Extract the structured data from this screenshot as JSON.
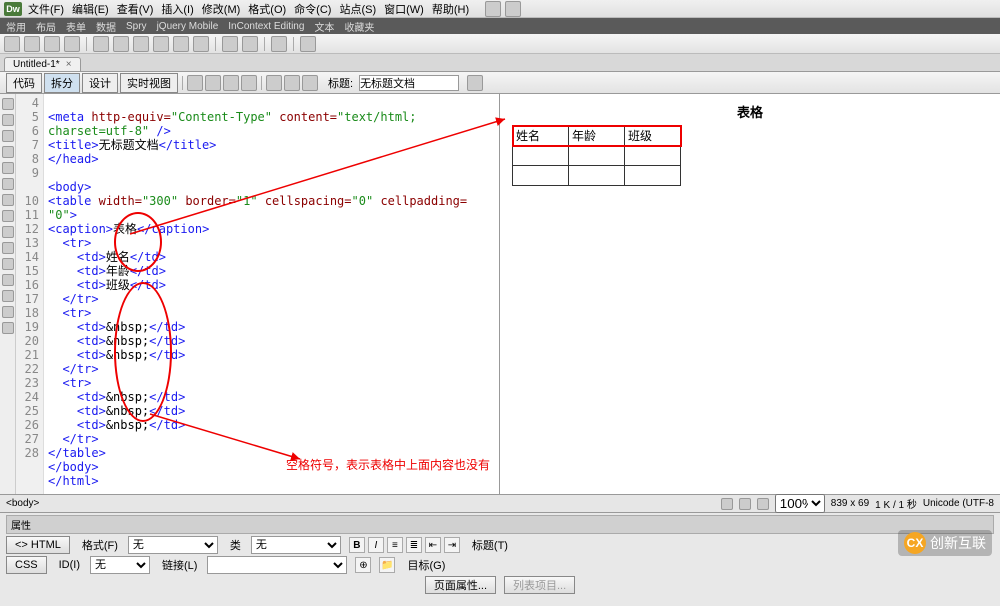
{
  "menu": {
    "items": [
      "文件(F)",
      "编辑(E)",
      "查看(V)",
      "插入(I)",
      "修改(M)",
      "格式(O)",
      "命令(C)",
      "站点(S)",
      "窗口(W)",
      "帮助(H)"
    ]
  },
  "categories": {
    "items": [
      "常用",
      "布局",
      "表单",
      "数据",
      "Spry",
      "jQuery Mobile",
      "InContext Editing",
      "文本",
      "收藏夹"
    ]
  },
  "tab": {
    "name": "Untitled-1*",
    "close": "×"
  },
  "viewbuttons": {
    "code": "代码",
    "split": "拆分",
    "design": "设计",
    "live": "实时视图"
  },
  "titlebar": {
    "label": "标题:",
    "value": "无标题文档"
  },
  "code": {
    "lines": [
      4,
      5,
      6,
      7,
      8,
      9,
      10,
      11,
      12,
      13,
      14,
      15,
      16,
      17,
      18,
      19,
      20,
      21,
      22,
      23,
      24,
      25,
      26,
      27,
      28
    ],
    "l4": "<meta http-equiv=\"Content-Type\" content=\"text/html; charset=utf-8\" />",
    "l5": "<title>无标题文档</title>",
    "l6": "</head>",
    "l7": "",
    "l8": "<body>",
    "l9": "<table width=\"300\" border=\"1\" cellspacing=\"0\" cellpadding=\"0\">",
    "l10": "<caption>表格</caption>",
    "l11": "  <tr>",
    "l12": "    <td>姓名</td>",
    "l13": "    <td>年龄</td>",
    "l14": "    <td>班级</td>",
    "l15": "  </tr>",
    "l16": "  <tr>",
    "l17": "    <td>&nbsp;</td>",
    "l18": "    <td>&nbsp;</td>",
    "l19": "    <td>&nbsp;</td>",
    "l20": "  </tr>",
    "l21": "  <tr>",
    "l22": "    <td>&nbsp;</td>",
    "l23": "    <td>&nbsp;</td>",
    "l24": "    <td>&nbsp;</td>",
    "l25": "  </tr>",
    "l26": "</table>",
    "l27": "</body>",
    "l28": "</html>"
  },
  "preview": {
    "caption": "表格",
    "headers": [
      "姓名",
      "年龄",
      "班级"
    ]
  },
  "annotation": {
    "text": "空格符号，表示表格中上面内容也没有"
  },
  "tagpath": {
    "path": "<body>",
    "zoom": "100%",
    "dims": "839 x 69",
    "size": "1 K / 1 秒",
    "enc": "Unicode (UTF-8"
  },
  "props": {
    "header": "属性",
    "htmlBtn": "<> HTML",
    "cssBtn": "CSS",
    "formatLabel": "格式(F)",
    "formatVal": "无",
    "idLabel": "ID(I)",
    "idVal": "无",
    "classLabel": "类",
    "classVal": "无",
    "linkLabel": "链接(L)",
    "titleLabel": "标题(T)",
    "targetLabel": "目标(G)",
    "pageProps": "页面属性...",
    "listItems": "列表项目..."
  },
  "watermark": {
    "text": "创新互联"
  }
}
